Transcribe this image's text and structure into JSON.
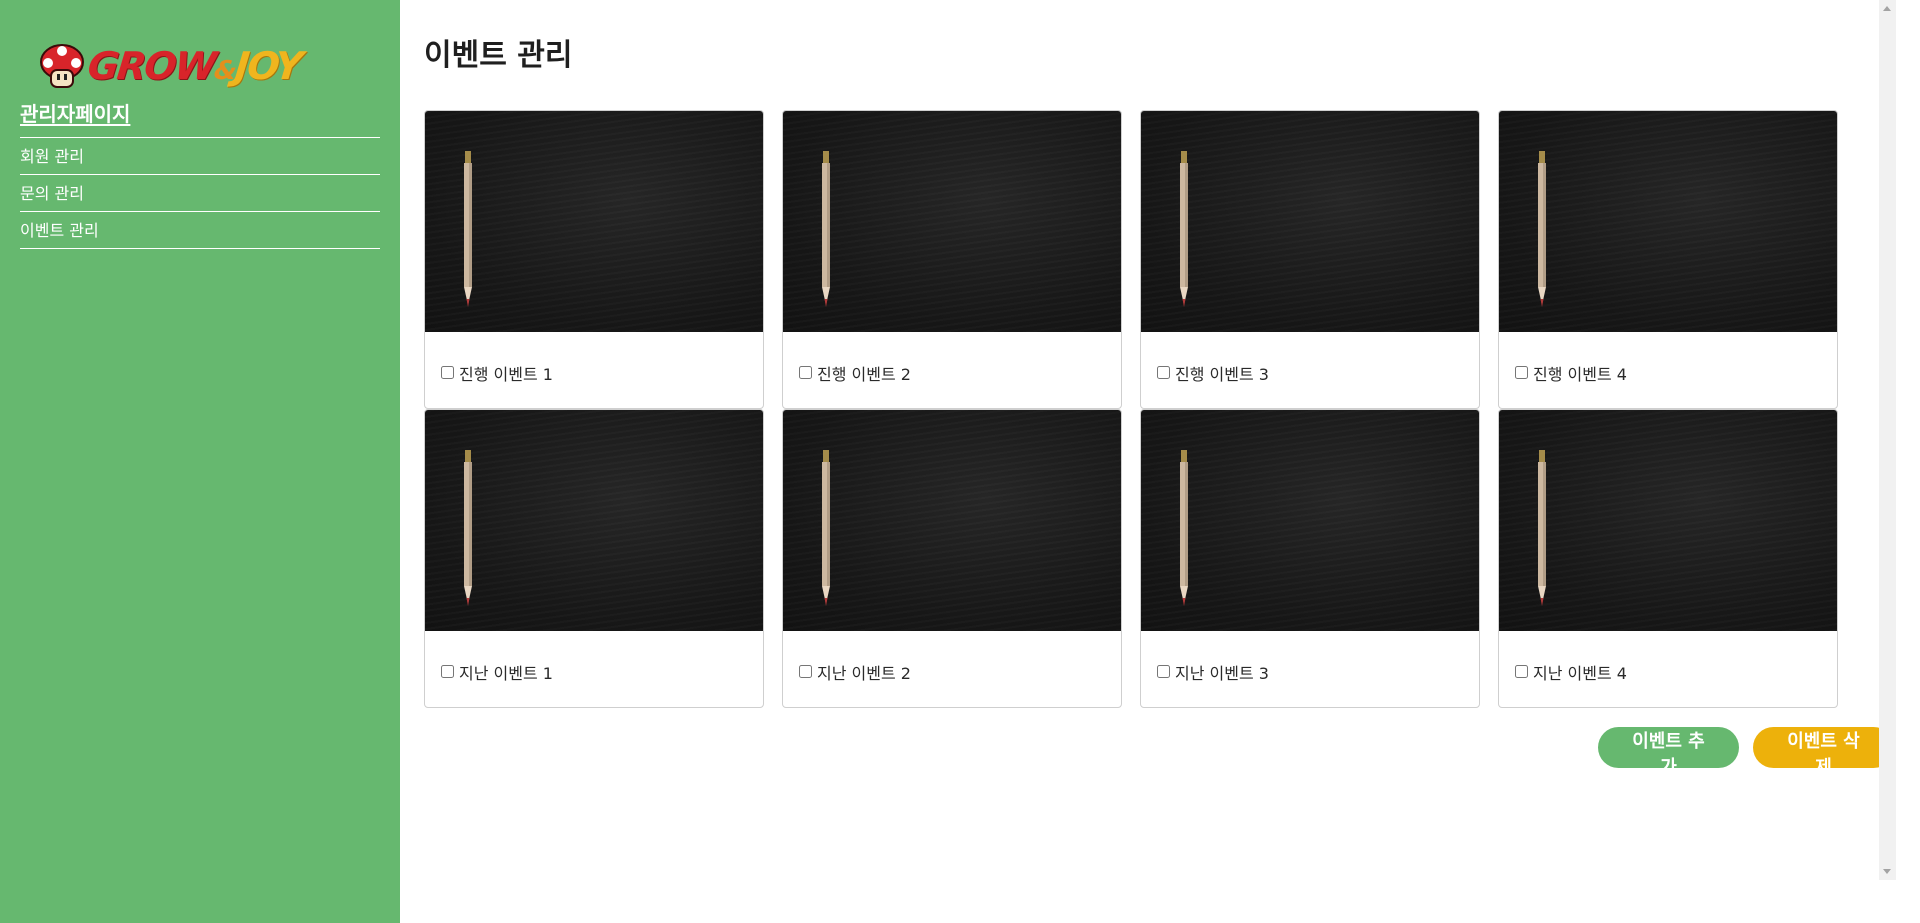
{
  "sidebar": {
    "logo": {
      "grow": "GROW",
      "amp": "&",
      "joy": "JOY"
    },
    "admin_title": "관리자페이지",
    "nav": [
      {
        "label": "회원 관리"
      },
      {
        "label": "문의 관리"
      },
      {
        "label": "이벤트 관리"
      }
    ]
  },
  "main": {
    "title": "이벤트 관리",
    "events": [
      {
        "label": "진행 이벤트 1"
      },
      {
        "label": "진행 이벤트 2"
      },
      {
        "label": "진행 이벤트 3"
      },
      {
        "label": "진행 이벤트 4"
      },
      {
        "label": "지난 이벤트 1"
      },
      {
        "label": "지난 이벤트 2"
      },
      {
        "label": "지난 이벤트 3"
      },
      {
        "label": "지난 이벤트 4"
      }
    ],
    "actions": {
      "add_label": "이벤트 추가",
      "delete_label": "이벤트 삭제"
    }
  },
  "colors": {
    "sidebar_bg": "#66b86f",
    "add_button": "#66b86f",
    "delete_button": "#edb10b"
  },
  "icons": [
    "mushroom-logo-icon",
    "pencil-image",
    "chevron-up-icon",
    "chevron-down-icon"
  ]
}
